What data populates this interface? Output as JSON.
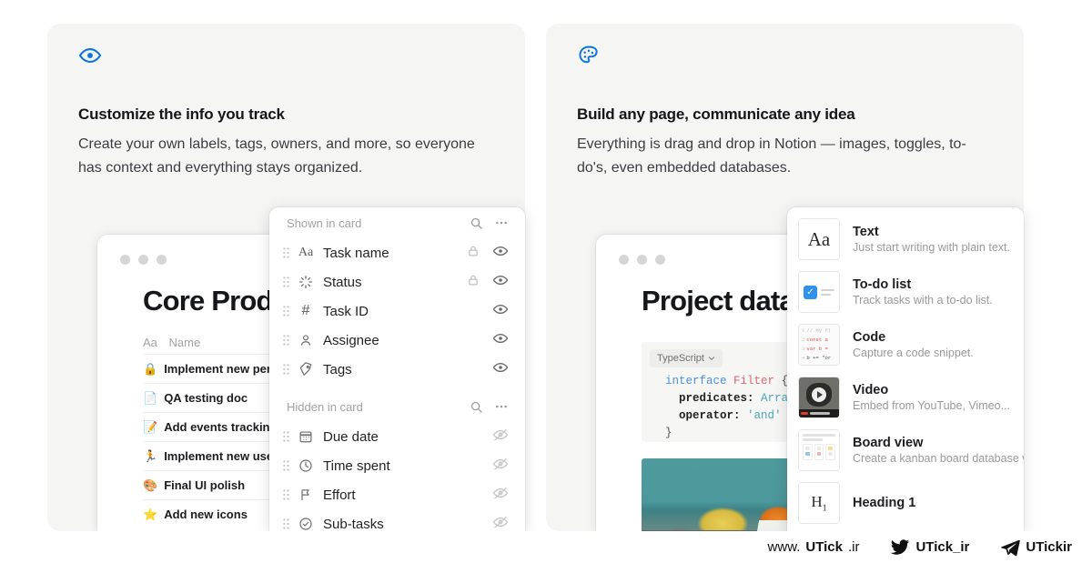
{
  "cards": [
    {
      "icon": "eye-icon",
      "icon_color": "#0b74de",
      "title": "Customize the info you track",
      "desc": "Create your own labels, tags, owners, and more, so everyone has context and everything stays organized."
    },
    {
      "icon": "palette-icon",
      "icon_color": "#0b74de",
      "title": "Build any page, communicate any idea",
      "desc": "Everything is drag and drop in Notion — images, toggles, to-do's, even embedded databases."
    }
  ],
  "left_window": {
    "title": "Core Produ",
    "table": {
      "column_icon": "Aa",
      "column_header": "Name",
      "rows": [
        {
          "emoji": "🔒",
          "name": "Implement new perm"
        },
        {
          "emoji": "📄",
          "name": "QA testing doc"
        },
        {
          "emoji": "📝",
          "name": "Add events tracking"
        },
        {
          "emoji": "🏃",
          "name": "Implement new user"
        },
        {
          "emoji": "🎨",
          "name": "Final UI polish"
        },
        {
          "emoji": "⭐",
          "name": "Add new icons"
        }
      ]
    }
  },
  "property_panel": {
    "sections": [
      {
        "heading": "Shown in card",
        "search_icon": "search-icon",
        "more_icon": "ellipsis-icon",
        "rows": [
          {
            "handle": "drag-handle-icon",
            "type_icon": "text-aa-icon",
            "type_glyph": "Aa",
            "label": "Task name",
            "locked": true,
            "lock_icon": "lock-icon",
            "visibility_icon": "eye-icon"
          },
          {
            "handle": "drag-handle-icon",
            "type_icon": "status-spinner-icon",
            "type_glyph": "",
            "label": "Status",
            "locked": true,
            "lock_icon": "lock-icon",
            "visibility_icon": "eye-icon"
          },
          {
            "handle": "drag-handle-icon",
            "type_icon": "number-hash-icon",
            "type_glyph": "#",
            "label": "Task ID",
            "locked": false,
            "lock_icon": "",
            "visibility_icon": "eye-icon"
          },
          {
            "handle": "drag-handle-icon",
            "type_icon": "person-icon",
            "type_glyph": "",
            "label": "Assignee",
            "locked": false,
            "lock_icon": "",
            "visibility_icon": "eye-icon"
          },
          {
            "handle": "drag-handle-icon",
            "type_icon": "tag-icon",
            "type_glyph": "",
            "label": "Tags",
            "locked": false,
            "lock_icon": "",
            "visibility_icon": "eye-icon"
          }
        ]
      },
      {
        "heading": "Hidden in card",
        "search_icon": "search-icon",
        "more_icon": "ellipsis-icon",
        "rows": [
          {
            "handle": "drag-handle-icon",
            "type_icon": "calendar-icon",
            "type_glyph": "",
            "label": "Due date",
            "locked": false,
            "lock_icon": "",
            "visibility_icon": "eye-off-icon"
          },
          {
            "handle": "drag-handle-icon",
            "type_icon": "clock-icon",
            "type_glyph": "",
            "label": "Time spent",
            "locked": false,
            "lock_icon": "",
            "visibility_icon": "eye-off-icon"
          },
          {
            "handle": "drag-handle-icon",
            "type_icon": "flag-icon",
            "type_glyph": "",
            "label": "Effort",
            "locked": false,
            "lock_icon": "",
            "visibility_icon": "eye-off-icon"
          },
          {
            "handle": "drag-handle-icon",
            "type_icon": "check-circle-icon",
            "type_glyph": "",
            "label": "Sub-tasks",
            "locked": false,
            "lock_icon": "",
            "visibility_icon": "eye-off-icon"
          }
        ]
      }
    ]
  },
  "right_window": {
    "title": "Project data",
    "code_block": {
      "language": "TypeScript",
      "chevron_icon": "chevron-down-icon",
      "lines": [
        {
          "kw": "interface",
          "type": "Filter",
          "punc": "{"
        },
        {
          "id": "predicates:",
          "cls": "Array"
        },
        {
          "id": "operator:",
          "str": "'and'"
        },
        {
          "punc": "}"
        }
      ]
    },
    "image_block": {
      "alt": "still-life-painting-apples-oranges"
    }
  },
  "block_menu": {
    "items": [
      {
        "thumb": "text-aa-thumbnail",
        "glyph": "Aa",
        "title": "Text",
        "sub": "Just start writing with plain text."
      },
      {
        "thumb": "todo-checkbox-thumbnail",
        "glyph": "✓",
        "title": "To-do list",
        "sub": "Track tasks with a to-do list."
      },
      {
        "thumb": "code-snippet-thumbnail",
        "glyph": "",
        "title": "Code",
        "sub": "Capture a code snippet.",
        "code_preview": [
          {
            "n": "1",
            "t": "// My f("
          },
          {
            "n": "2",
            "t": "const a"
          },
          {
            "n": "3",
            "t": "var b ="
          },
          {
            "n": "4",
            "t": "b += \"or"
          }
        ]
      },
      {
        "thumb": "video-play-thumbnail",
        "glyph": "",
        "title": "Video",
        "sub": "Embed from YouTube, Vimeo..."
      },
      {
        "thumb": "board-view-thumbnail",
        "glyph": "",
        "title": "Board view",
        "sub": "Create a kanban board database v"
      },
      {
        "thumb": "heading-h1-thumbnail",
        "glyph": "H1",
        "title": "Heading 1",
        "sub": ""
      }
    ]
  },
  "footer": {
    "website": {
      "prefix": "www.",
      "brand": "UTick",
      "suffix": ".ir"
    },
    "twitter": {
      "icon": "twitter-bird-icon",
      "handle": "UTick_ir"
    },
    "telegram": {
      "icon": "telegram-plane-icon",
      "handle": "UTickir"
    }
  }
}
